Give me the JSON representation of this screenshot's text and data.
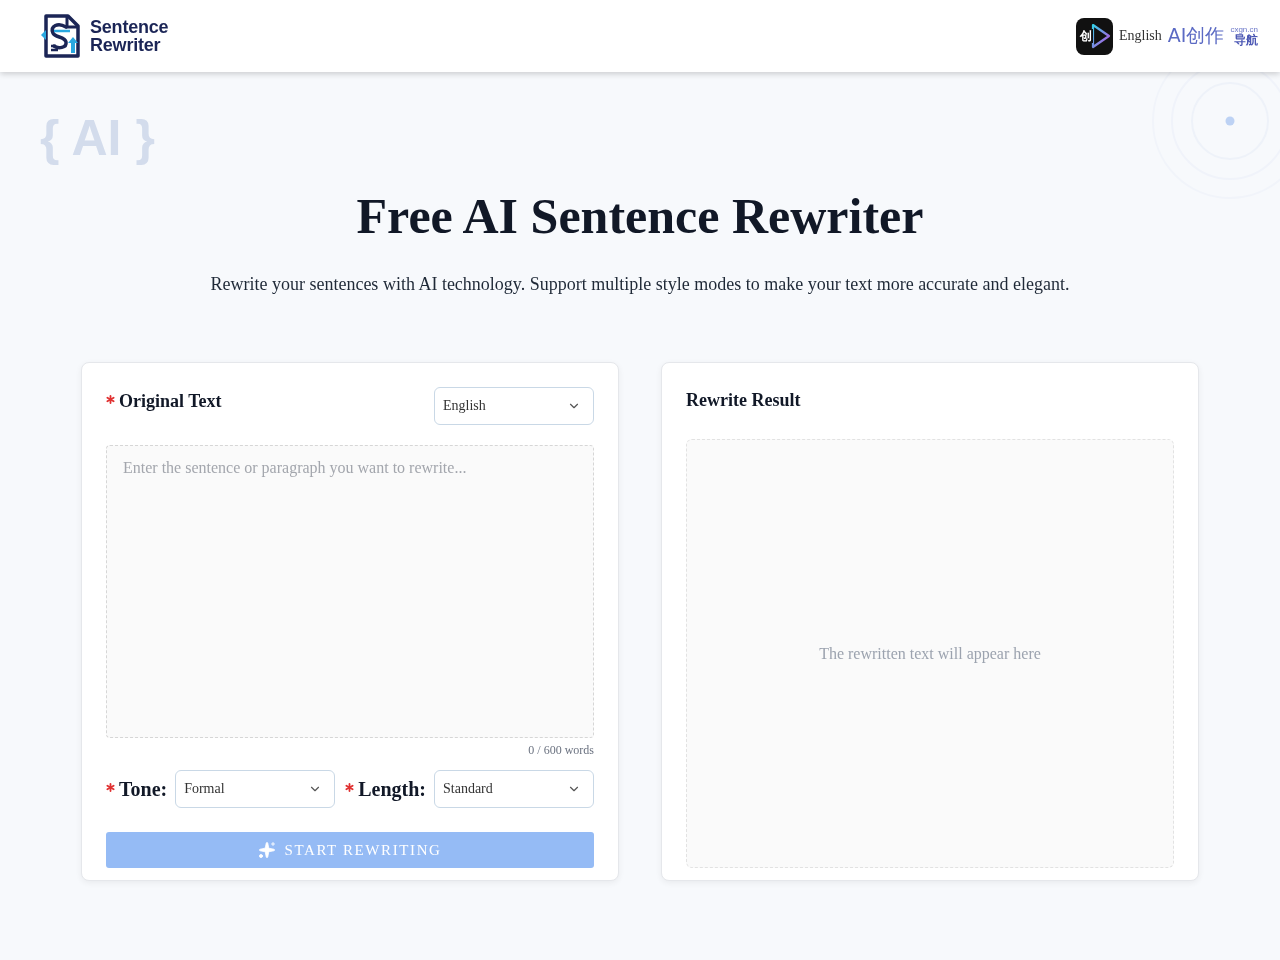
{
  "header": {
    "logo": {
      "line1": "Sentence",
      "line2": "Rewriter"
    },
    "language_link": "English",
    "partner_badge": {
      "tile_char": "创",
      "title": "AI创作",
      "domain": "cxgn.cn",
      "subtitle": "导航"
    }
  },
  "hero": {
    "decor_text": "{ AI }",
    "title": "Free AI Sentence Rewriter",
    "subtitle": "Rewrite your sentences with AI technology. Support multiple style modes to make your text more accurate and elegant."
  },
  "input_panel": {
    "title": "Original Text",
    "required": true,
    "language_select": {
      "value": "English"
    },
    "textarea": {
      "placeholder": "Enter the sentence or paragraph you want to rewrite..."
    },
    "word_count": "0 / 600 words",
    "options": [
      {
        "label": "Tone:",
        "required": true,
        "value": "Formal"
      },
      {
        "label": "Length:",
        "required": true,
        "value": "Standard"
      }
    ],
    "submit_button": {
      "label": "START REWRITING",
      "disabled": true
    }
  },
  "result_panel": {
    "title": "Rewrite Result",
    "placeholder": "The rewritten text will appear here"
  }
}
